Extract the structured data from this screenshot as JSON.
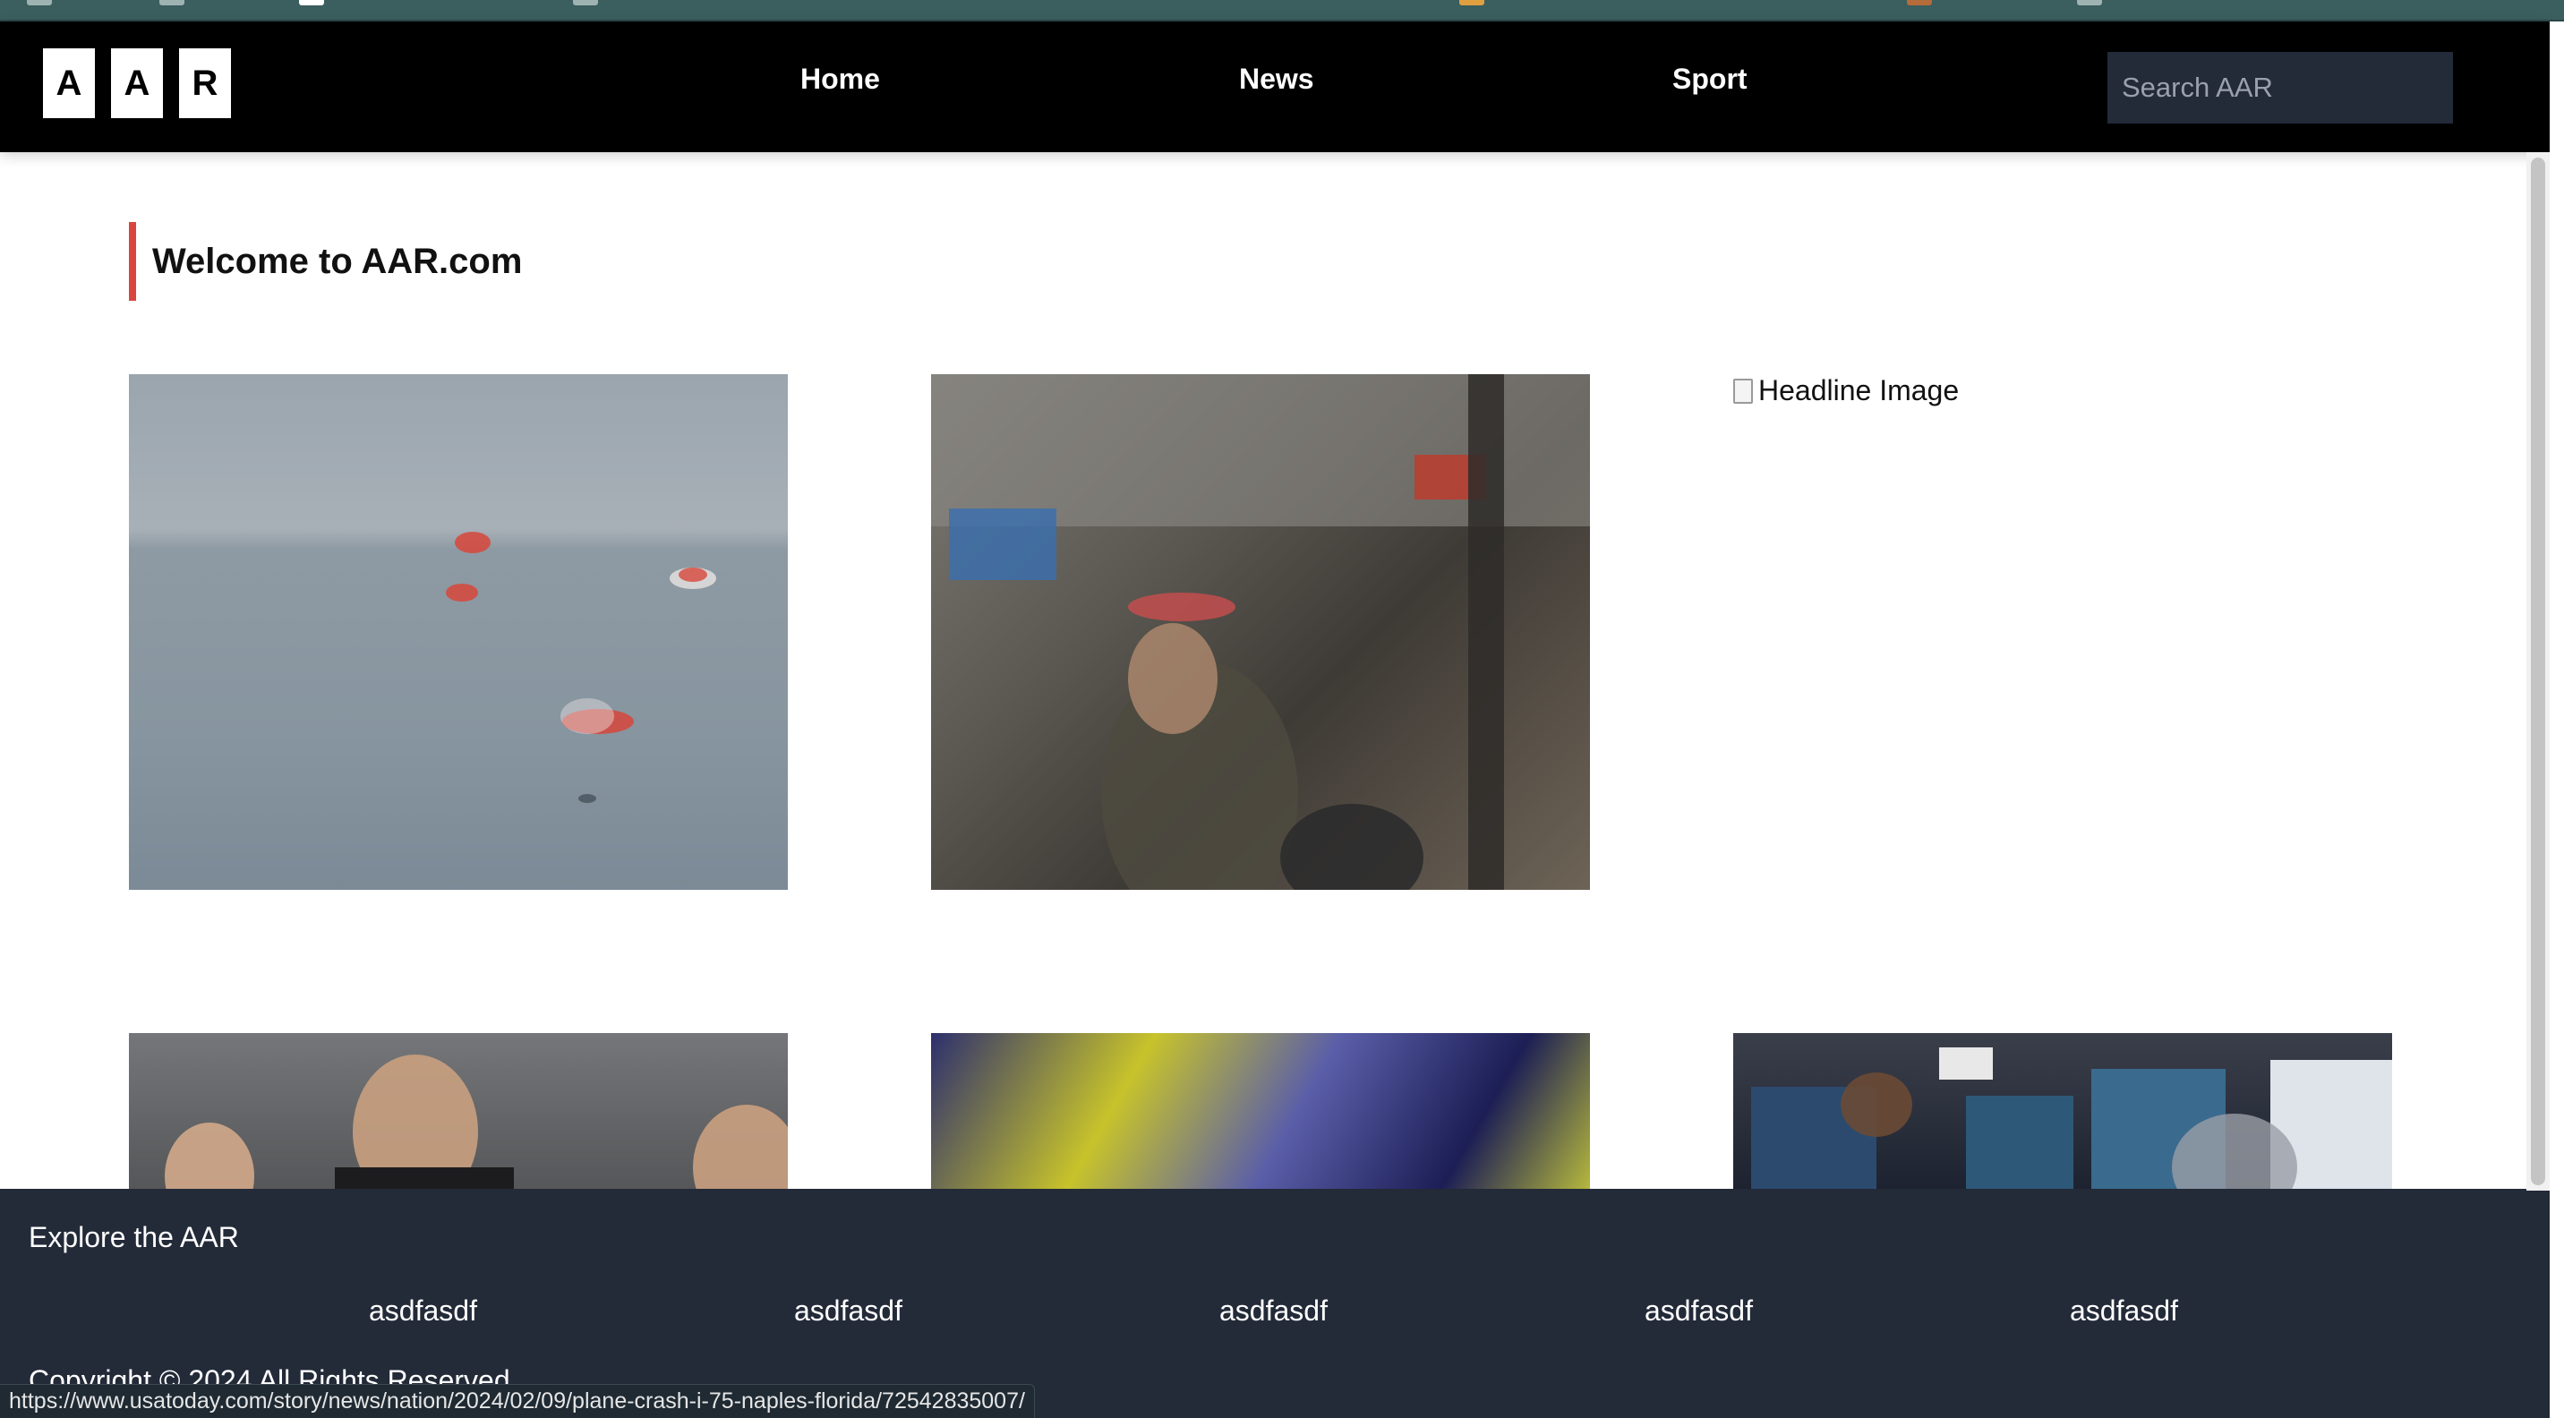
{
  "header": {
    "logo_letters": [
      "A",
      "A",
      "R"
    ],
    "nav": [
      "Home",
      "News",
      "Sport"
    ],
    "search_placeholder": "Search AAR"
  },
  "main": {
    "welcome_title": "Welcome to AAR.com",
    "broken_image_alt": "Headline Image"
  },
  "footer": {
    "title": "Explore the AAR",
    "links": [
      "asdfasdf",
      "asdfasdf",
      "asdfasdf",
      "asdfasdf",
      "asdfasdf"
    ],
    "copyright": "Copyright © 2024 All Rights Reserved"
  },
  "status_bar": {
    "url": "https://www.usatoday.com/story/news/nation/2024/02/09/plane-crash-i-75-naples-florida/72542835007/"
  },
  "colors": {
    "header_bg": "#000000",
    "accent": "#d9463e",
    "footer_bg": "#232a38"
  }
}
